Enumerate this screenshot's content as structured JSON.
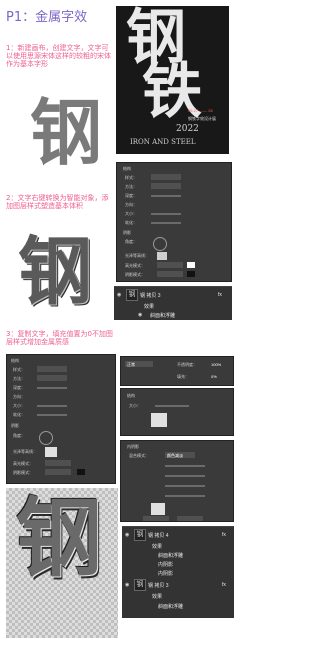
{
  "title": "P1：金属字效",
  "glyph_main": "钢",
  "steps": {
    "step1": "1：新建画布，创建文字，文字可以使用思源宋体这样的较粗的宋体作为基本字形",
    "step2": "2：文字右键转换为智能对象，添加图层样式塑造基本体积",
    "step3": "3：复制文字，填充值置为0不加图层样式增加金属质感"
  },
  "poster": {
    "glyph_1": "钢",
    "glyph_2": "铁",
    "date": "05.27 —— 26",
    "year": "2022",
    "caption": "钢铁字效设计展",
    "english": "IRON AND STEEL"
  },
  "layers_panel_1": {
    "layer_name": "钢 拷贝 3",
    "fx": "fx",
    "effects_label": "效果",
    "effect_1": "斜面和浮雕"
  },
  "layers_panel_2": {
    "blend_mode": "正常",
    "opacity_label": "不透明度：",
    "opacity": "100%",
    "fill_label": "填充：",
    "fill": "0%",
    "layer_a": "钢 拷贝 4",
    "layer_a_fx": "fx",
    "layer_a_effects": "效果",
    "layer_a_effect_1": "斜面和浮雕",
    "layer_a_effect_2": "内阴影",
    "layer_a_effect_3": "内阴影",
    "layer_b": "钢 拷贝 3",
    "layer_b_fx": "fx",
    "layer_b_effects": "效果",
    "layer_b_effect_1": "斜面和浮雕"
  },
  "ps_labels": {
    "structure": "结构",
    "style": "样式：",
    "style_val": "内斜面",
    "method": "方法：",
    "method_val": "雕刻清晰",
    "depth": "深度：",
    "direction": "方向：",
    "size": "大小：",
    "soften": "软化：",
    "shading": "阴影",
    "angle": "角度：",
    "altitude": "高度：",
    "gloss": "光泽等高线：",
    "highlight_mode": "高光模式：",
    "highlight_val": "正常",
    "shadow_mode": "阴影模式：",
    "shadow_val": "正片叠底",
    "default_btn": "设置为默认值",
    "reset_btn": "复位为默认值",
    "inner_shadow": "内阴影",
    "blend_mode2": "混合模式：",
    "color_dodge": "颜色减淡"
  },
  "colors": {
    "title": "#7c66c8",
    "pink": "#ef5f90",
    "ps_panel": "#3a3a3a",
    "poster_bg": "#181818"
  }
}
